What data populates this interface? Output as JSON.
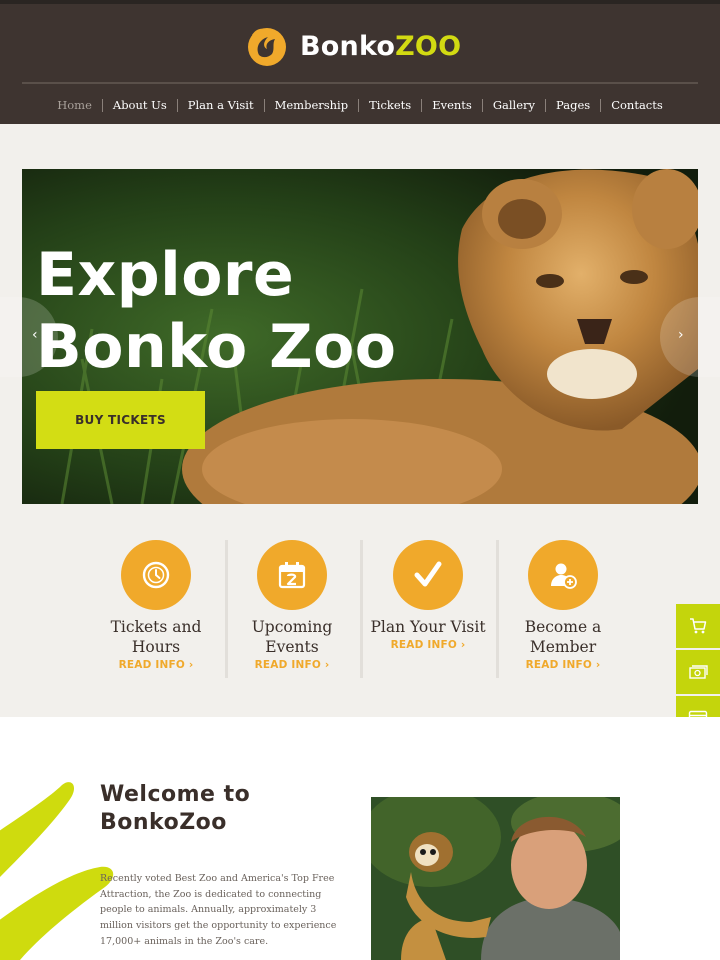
{
  "brand": {
    "name_part1": "Bonko",
    "name_part2": "ZOO",
    "accent": "#d2da12",
    "orange": "#f0a92b",
    "header_bg": "#3e3430"
  },
  "nav": {
    "items": [
      {
        "label": "Home",
        "active": true
      },
      {
        "label": "About Us"
      },
      {
        "label": "Plan a Visit"
      },
      {
        "label": "Membership"
      },
      {
        "label": "Tickets"
      },
      {
        "label": "Events"
      },
      {
        "label": "Gallery"
      },
      {
        "label": "Pages"
      },
      {
        "label": "Contacts"
      }
    ]
  },
  "hero": {
    "title_line1": "Explore",
    "title_line2": "Bonko Zoo",
    "cta_label": "BUY TICKETS",
    "prev_icon": "chevron-left-icon",
    "next_icon": "chevron-right-icon",
    "next_glyph": "›",
    "prev_glyph": "‹"
  },
  "features": [
    {
      "title_line1": "Tickets and",
      "title_line2": "Hours",
      "link": "READ INFO ›",
      "icon": "clock-icon"
    },
    {
      "title_line1": "Upcoming",
      "title_line2": "Events",
      "link": "READ INFO ›",
      "icon": "calendar-icon"
    },
    {
      "title_line1": "Plan Your Visit",
      "title_line2": "",
      "link": "READ INFO ›",
      "icon": "checkmark-icon"
    },
    {
      "title_line1": "Become a",
      "title_line2": "Member",
      "link": "READ INFO ›",
      "icon": "add-user-icon"
    }
  ],
  "side_widgets": [
    {
      "icon": "cart-icon"
    },
    {
      "icon": "money-icon"
    },
    {
      "icon": "browser-icon"
    }
  ],
  "welcome": {
    "title_line1": "Welcome to",
    "title_line2": "BonkoZoo",
    "body": "Recently voted Best Zoo and America's Top Free Attraction, the Zoo is dedicated to connecting people to animals. Annually, approximately 3 million visitors get the opportunity to experience 17,000+ animals in the Zoo's care."
  }
}
